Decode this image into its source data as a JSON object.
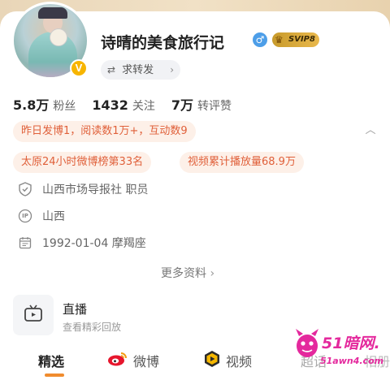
{
  "profile": {
    "name": "诗晴的美食旅行记",
    "gender_symbol": "♂",
    "svip_label": "SVIP8",
    "verified_mark": "V",
    "repost_label": "求转发"
  },
  "stats": [
    {
      "value": "5.8万",
      "label": "粉丝"
    },
    {
      "value": "1432",
      "label": "关注"
    },
    {
      "value": "7万",
      "label": "转评赞"
    }
  ],
  "highlights": {
    "yesterday": "昨日发博1，阅读数1万+，互动数9",
    "rank": "太原24小时微博榜第33名",
    "video_plays": "视频累计播放量68.9万"
  },
  "info": {
    "job": "山西市场导报社 职员",
    "ip": "山西",
    "ip_badge": "IP",
    "birthday": "1992-01-04 摩羯座"
  },
  "more_label": "更多资料",
  "live": {
    "title": "直播",
    "subtitle": "查看精彩回放"
  },
  "tabs": [
    {
      "label": "精选"
    },
    {
      "label": "微博"
    },
    {
      "label": "视频"
    },
    {
      "label": "超话"
    },
    {
      "label": "相册"
    }
  ],
  "watermark": {
    "brand": "51暗网.",
    "url": "51awn4.com"
  },
  "colors": {
    "accent_orange": "#e0603a",
    "pill_bg": "#fdf0e8",
    "tab_underline": "#f08c2e",
    "verified_yellow": "#f7b500",
    "gender_blue": "#4d9ee8",
    "watermark_pink": "#e4299d"
  },
  "icons": {
    "job": "verified-shield-icon",
    "ip": "ip-location-icon",
    "birthday": "calendar-icon",
    "live": "tv-icon",
    "weibo": "weibo-logo-icon",
    "video": "video-play-icon"
  }
}
